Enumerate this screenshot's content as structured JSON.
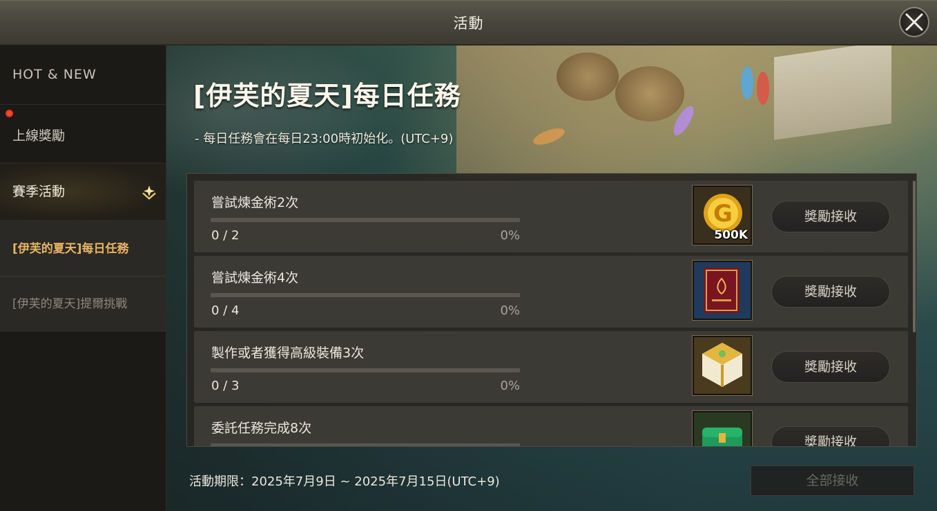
{
  "window": {
    "title": "活動"
  },
  "sidebar": {
    "items": [
      {
        "label": "HOT & NEW"
      },
      {
        "label": "上線獎勵",
        "has_notification": true
      },
      {
        "label": "賽季活動",
        "expanded": true
      }
    ],
    "sub_items": [
      {
        "label": "[伊芙的夏天]每日任務",
        "selected": true
      },
      {
        "label": "[伊芙的夏天]提爾挑戰",
        "selected": false
      }
    ]
  },
  "event": {
    "title": "[伊芙的夏天]每日任務",
    "subtitle": "- 每日任務會在每日23:00時初始化。(UTC+9)"
  },
  "missions": [
    {
      "title": "嘗試煉金術2次",
      "count": "0 / 2",
      "percent": "0%",
      "progress": 0,
      "reward_icon": "gold-coin-icon",
      "reward_amount": "500K",
      "button": "獎勵接收"
    },
    {
      "title": "嘗試煉金術4次",
      "count": "0 / 4",
      "percent": "0%",
      "progress": 0,
      "reward_icon": "red-book-icon",
      "reward_amount": "",
      "button": "獎勵接收"
    },
    {
      "title": "製作或者獲得高級裝備3次",
      "count": "0 / 3",
      "percent": "0%",
      "progress": 0,
      "reward_icon": "gold-box-icon",
      "reward_amount": "",
      "button": "獎勵接收"
    },
    {
      "title": "委託任務完成8次",
      "count": "",
      "percent": "",
      "progress": 0,
      "reward_icon": "green-chest-icon",
      "reward_amount": "",
      "button": "獎勵接收"
    }
  ],
  "footer": {
    "period": "活動期限：2025年7月9日 ~ 2025年7月15日(UTC+9)",
    "claim_all": "全部接收"
  },
  "colors": {
    "selected_sub_item": "#e8b463",
    "progress_fill": "#c8a660",
    "notification": "#ff4a2a"
  }
}
